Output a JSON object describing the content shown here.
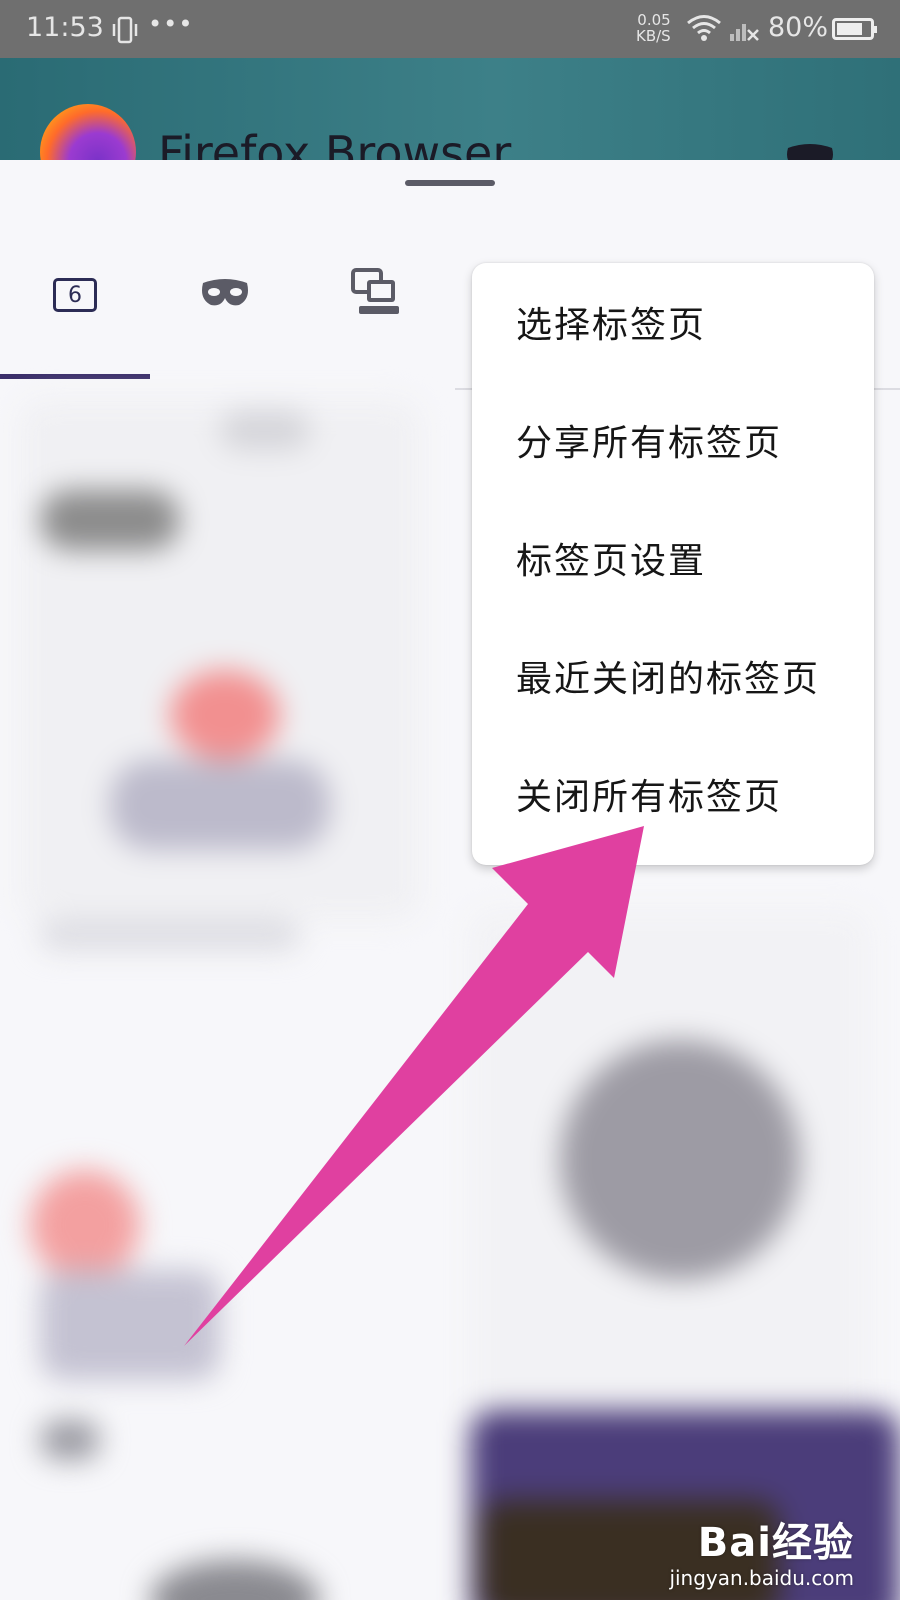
{
  "status_bar": {
    "time": "11:53",
    "dots": "•••",
    "speed_value": "0.05",
    "speed_unit": "KB/S",
    "battery_text": "80%",
    "battery_level": 0.8
  },
  "header": {
    "title": "Firefox Browser"
  },
  "tabs": {
    "normal_count": "6",
    "selected": "normal",
    "icons": [
      "tabs-count-icon",
      "private-mask-icon",
      "synced-devices-icon"
    ]
  },
  "menu": {
    "items": [
      {
        "label": "选择标签页"
      },
      {
        "label": "分享所有标签页"
      },
      {
        "label": "标签页设置"
      },
      {
        "label": "最近关闭的标签页"
      },
      {
        "label": "关闭所有标签页"
      }
    ]
  },
  "annotation": {
    "arrow_color": "#e040a0"
  },
  "watermark": {
    "logo": "Bai经验",
    "url": "jingyan.baidu.com"
  }
}
